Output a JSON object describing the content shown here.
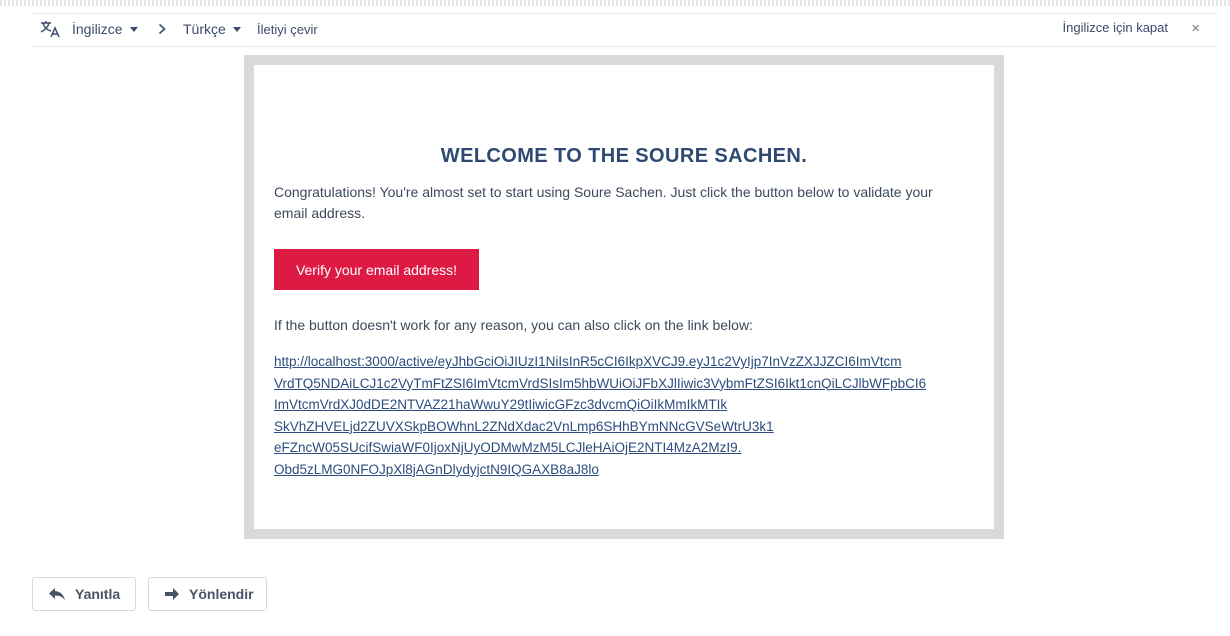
{
  "translate_bar": {
    "source_language": "İngilizce",
    "target_language": "Türkçe",
    "translate_message": "İletiyi çevir",
    "close_label": "İngilizce için kapat",
    "close_symbol": "×"
  },
  "email": {
    "title": "WELCOME TO THE SOURE SACHEN.",
    "intro": "Congratulations! You're almost set to start using Soure Sachen. Just click the button below to validate your email address.",
    "verify_button_label": "Verify your email address!",
    "fallback_text": "If the button doesn't work for any reason, you can also click on the link below:",
    "link_lines": [
      "http://localhost:3000/active/eyJhbGciOiJIUzI1NiIsInR5cCI6IkpXVCJ9.eyJ1c2VyIjp7InVzZXJJZCI6ImVtcm",
      "VrdTQ5NDAiLCJ1c2VyTmFtZSI6ImVtcmVrdSIsIm5hbWUiOiJFbXJlIiwic3VybmFtZSI6Ikt1cnQiLCJlbWFpbCI6",
      "ImVtcmVrdXJ0dDE2NTVAZ21haWwuY29tIiwicGFzc3dvcmQiOiIkMmIkMTIk",
      "SkVhZHVELjd2ZUVXSkpBOWhnL2ZNdXdac2VnLmp6SHhBYmNNcGVSeWtrU3k1",
      "eFZncW05SUcifSwiaWF0IjoxNjUyODMwMzM5LCJleHAiOjE2NTI4MzA2MzI9.",
      "Obd5zLMG0NFOJpXl8jAGnDlydyjctN9IQGAXB8aJ8lo"
    ],
    "brand_colors": {
      "title": "#2e4a72",
      "button": "#dd1a43",
      "frame": "#dadada"
    }
  },
  "actions": {
    "reply_label": "Yanıtla",
    "forward_label": "Yönlendir"
  }
}
